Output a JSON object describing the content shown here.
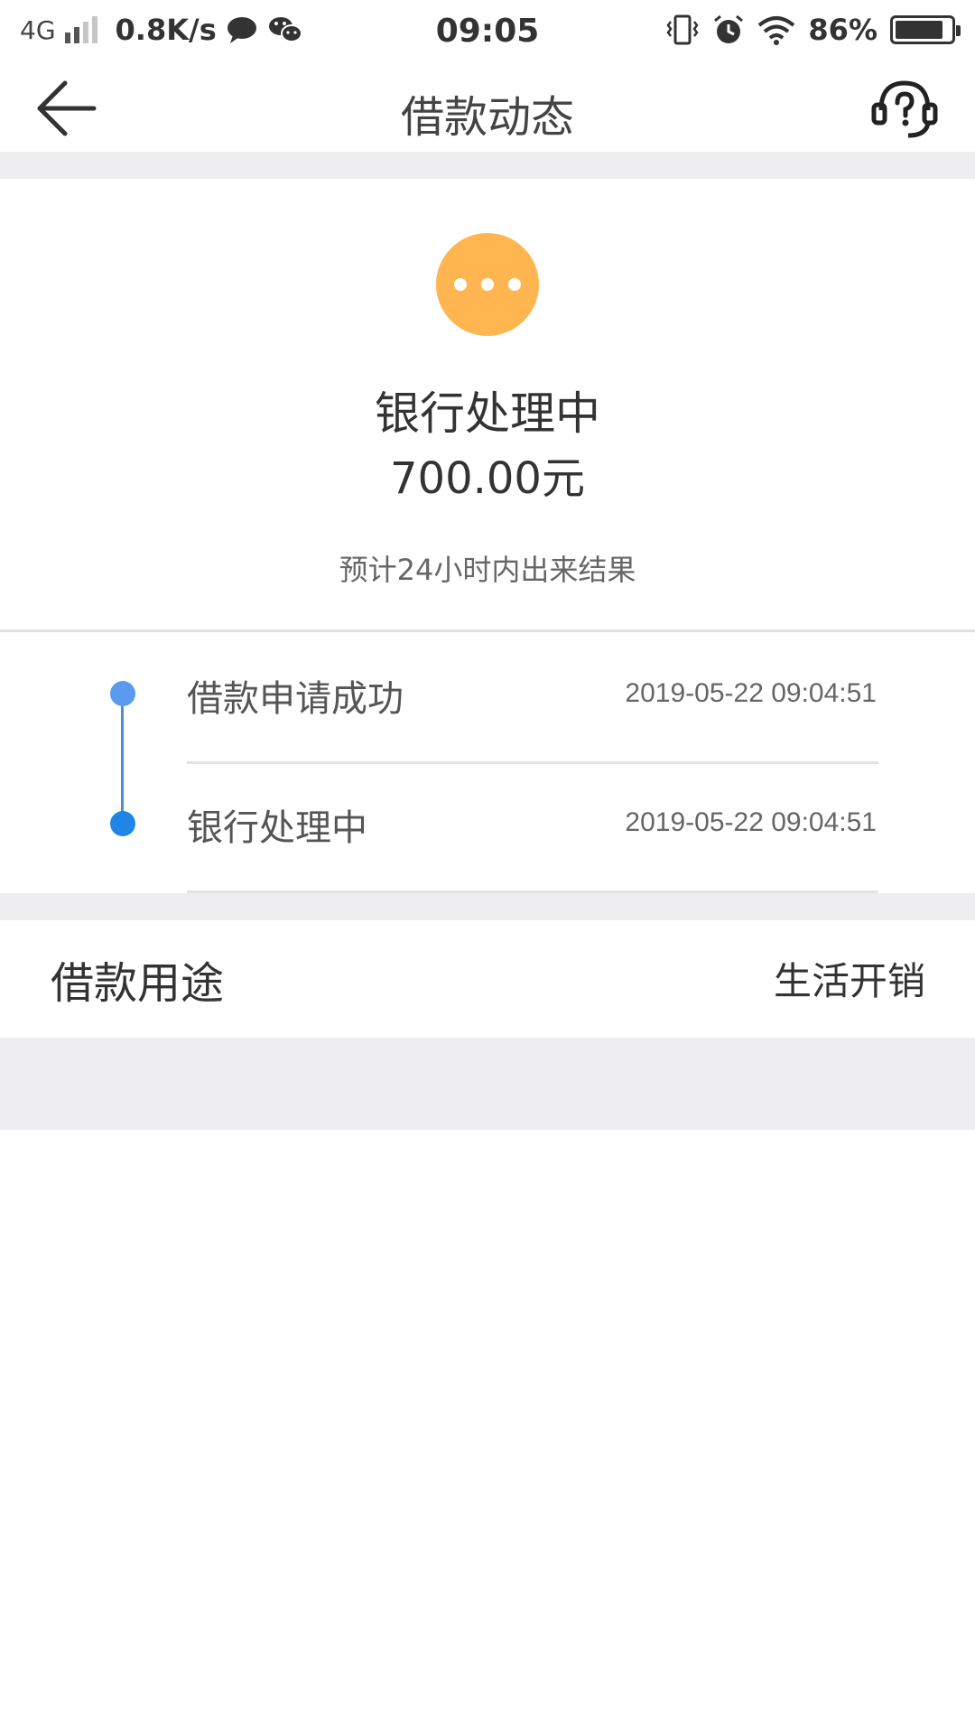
{
  "status_bar": {
    "network": "4G",
    "speed": "0.8K/s",
    "time": "09:05",
    "battery": "86%",
    "icons": [
      "signal-icon",
      "chat-bubble-icon",
      "wechat-icon",
      "vibrate-icon",
      "alarm-icon",
      "wifi-icon",
      "battery-icon"
    ]
  },
  "header": {
    "title": "借款动态",
    "back_icon": "arrow-left-icon",
    "help_icon": "customer-service-help-icon"
  },
  "status_card": {
    "title": "银行处理中",
    "amount": "700.00元",
    "hint": "预计24小时内出来结果",
    "icon": "pending-dots-icon",
    "icon_color": "#ffb650"
  },
  "timeline": [
    {
      "label": "借款申请成功",
      "time": "2019-05-22 09:04:51",
      "dot_color": "#5a9bef"
    },
    {
      "label": "银行处理中",
      "time": "2019-05-22 09:04:51",
      "dot_color": "#1f86e8"
    }
  ],
  "purpose": {
    "label": "借款用途",
    "value": "生活开销"
  },
  "colors": {
    "background_gap": "#eeeef1",
    "accent_blue": "#4a90e2",
    "pending_orange": "#ffb650"
  }
}
